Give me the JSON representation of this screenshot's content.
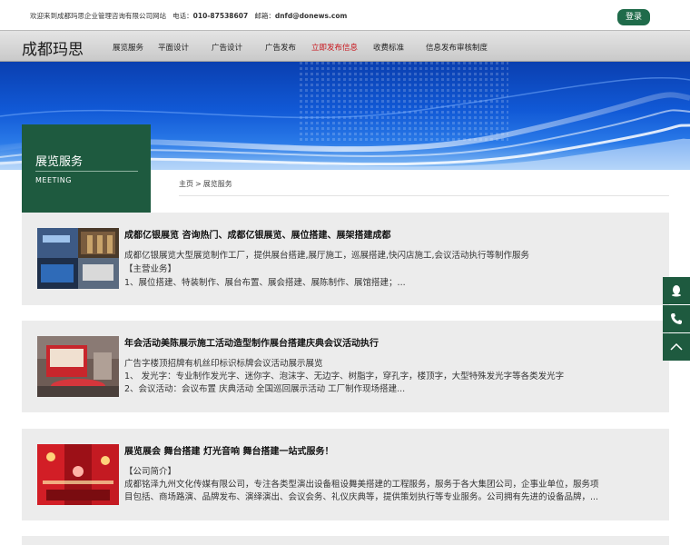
{
  "topbar": {
    "welcome": "欢迎来到成都玛思企业管理咨询有限公司网站",
    "phone_label": "电话：",
    "phone": "010-87538607",
    "email_label": "邮箱：",
    "email": "dnfd@donews.com",
    "login": "登录"
  },
  "logo": "成都玛思",
  "nav": [
    "展览服务",
    "平面设计",
    "广告设计",
    "广告发布",
    "立即发布信息",
    "收费标准",
    "信息发布审核制度"
  ],
  "nav_active_index": 4,
  "section": {
    "title": "展览服务",
    "subtitle": "MEETING"
  },
  "breadcrumb": {
    "home": "主页",
    "sep": ">",
    "current": "展览服务"
  },
  "cards": [
    {
      "title": "成都亿银展览 咨询热门、成都亿银展览、展位搭建、展架搭建成都",
      "lines": [
        "成都亿银展览大型展览制作工厂，提供展台搭建,展厅施工，巡展搭建,快闪店施工,会议活动执行等制作服务",
        "【主营业务】",
        "1、展位搭建、特装制作、展台布置、展会搭建、展陈制作、展馆搭建；..."
      ],
      "thumb_icon": "exhibition-photo"
    },
    {
      "title": "年会活动美陈展示施工活动造型制作展台搭建庆典会议活动执行",
      "lines": [
        "广告字楼顶招牌有机丝印标识标牌会议活动展示展览",
        "1、 发光字：专业制作发光字、迷你字、泡沫字、无边字、树脂字，穿孔字，楼顶字，大型特殊发光字等各类发光字",
        "2、会议活动：会议布置 庆典活动 全国巡回展示活动 工厂制作现场搭建..."
      ],
      "thumb_icon": "event-stage-photo"
    },
    {
      "title": "展览展会 舞台搭建 灯光音响 舞台搭建一站式服务！",
      "lines": [
        "【公司简介】",
        "成都铭泽九州文化传媒有限公司，专注各类型演出设备租设舞美搭建的工程服务，服务于各大集团公司，企事业单位，服务项",
        "目包括、商场路演、品牌发布、演绎演出、会议会务、礼仪庆典等，提供策划执行等专业服务。公司拥有先进的设备品牌，..."
      ],
      "thumb_icon": "stage-lighting-photo"
    }
  ],
  "side_buttons": [
    "qq-icon",
    "phone-icon",
    "back-to-top-icon"
  ],
  "colors": {
    "brand_green": "#1e5a3f",
    "nav_active": "#c8161d",
    "banner_blue": "#1159d6",
    "card_bg": "#ececec"
  }
}
